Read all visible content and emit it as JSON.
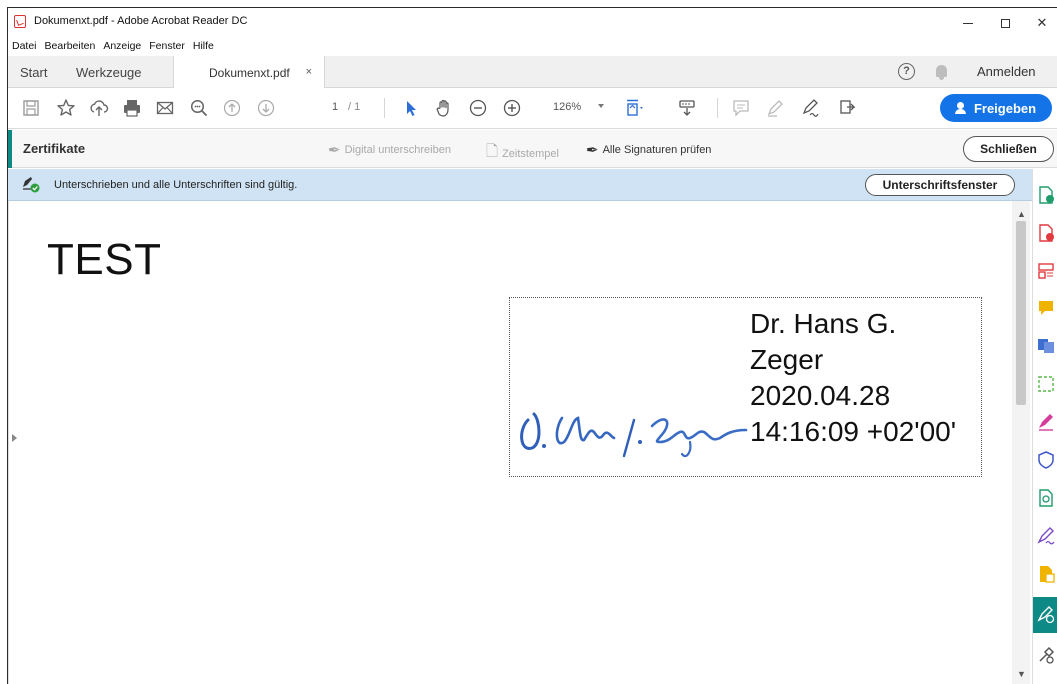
{
  "window": {
    "title": "Dokumenxt.pdf - Adobe Acrobat Reader DC",
    "minimize": "–",
    "close": "✕"
  },
  "menu": [
    "Datei",
    "Bearbeiten",
    "Anzeige",
    "Fenster",
    "Hilfe"
  ],
  "tabs": {
    "start": "Start",
    "tools": "Werkzeuge",
    "document": "Dokumenxt.pdf",
    "document_close": "×"
  },
  "header_right": {
    "help": "?",
    "signin": "Anmelden"
  },
  "toolbar": {
    "page_current": "1",
    "page_total": "/ 1",
    "zoom": "126%",
    "share_label": "Freigeben"
  },
  "certificates": {
    "title": "Zertifikate",
    "digital_sign": "Digital unterschreiben",
    "timestamp": "Zeitstempel",
    "validate_all": "Alle Signaturen prüfen",
    "close": "Schließen"
  },
  "signature_status": {
    "message": "Unterschrieben und alle Unterschriften sind gültig.",
    "panel_button": "Unterschriftsfenster"
  },
  "document": {
    "heading": "TEST",
    "signature": {
      "line1": "Dr. Hans G.",
      "line2": "Zeger",
      "line3": "2020.04.28",
      "line4": "14:16:09 +02'00'"
    }
  },
  "right_panel_icons": [
    "export-pdf-icon",
    "create-pdf-icon",
    "organize-pages-icon",
    "comment-icon",
    "edit-pdf-icon",
    "compress-icon",
    "fill-sign-icon",
    "protect-icon",
    "send-for-review-icon",
    "sign-icon",
    "export-icon",
    "certificates-icon",
    "more-tools-icon"
  ],
  "colors": {
    "accent": "#0e8a86",
    "share_button": "#1473e6",
    "status_bar": "#cfe3f4",
    "signature_ink": "#2f5fb8"
  }
}
